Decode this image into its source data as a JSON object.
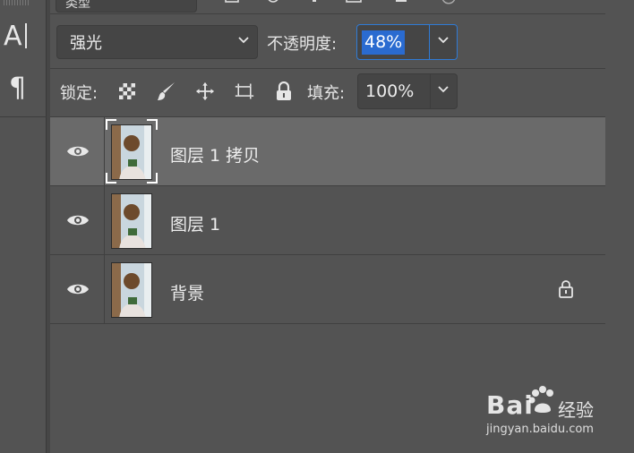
{
  "toolbar_top": {
    "partial_label": "类型"
  },
  "tools": [
    {
      "name": "character-panel",
      "glyph": "A|"
    },
    {
      "name": "paragraph-panel",
      "glyph": "¶"
    }
  ],
  "layers_panel": {
    "blend_mode": {
      "value": "强光"
    },
    "opacity": {
      "label": "不透明度:",
      "value": "48%"
    },
    "lock": {
      "label": "锁定:",
      "icons": [
        "lock-transparent-pixels-icon",
        "lock-image-pixels-icon",
        "lock-position-icon",
        "lock-artboard-icon",
        "lock-all-icon"
      ]
    },
    "fill": {
      "label": "填充:",
      "value": "100%"
    },
    "layers": [
      {
        "name": "图层 1 拷贝",
        "visible": true,
        "selected": true,
        "locked": false
      },
      {
        "name": "图层 1",
        "visible": true,
        "selected": false,
        "locked": false
      },
      {
        "name": "背景",
        "visible": true,
        "selected": false,
        "locked": true
      }
    ]
  },
  "watermark": {
    "brand": "Bai",
    "brand_suffix": "经验",
    "url": "jingyan.baidu.com"
  },
  "colors": {
    "panel_bg": "#535353",
    "selected_row": "#6a6a6a",
    "accent": "#2f7bd6"
  }
}
